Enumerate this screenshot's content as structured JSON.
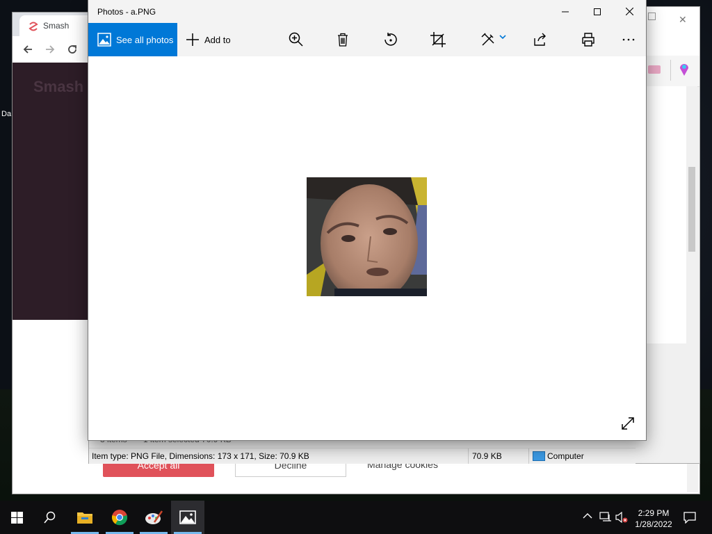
{
  "browser": {
    "tab_title": "Smash",
    "logo_text": "Smash",
    "cookie": {
      "accept_label": "Accept all",
      "decline_label": "Decline",
      "manage_label": "Manage cookies"
    }
  },
  "explorer": {
    "details_text": "Item type: PNG File, Dimensions: 173 x 171, Size: 70.9 KB",
    "size_text": "70.9 KB",
    "location_text": "Computer",
    "status_left": "3 items",
    "status_right": "1 item selected 70.9 KB"
  },
  "photos": {
    "title": "Photos - a.PNG",
    "toolbar": {
      "see_all_label": "See all photos",
      "add_to_label": "Add to",
      "icons": [
        "zoom-in-icon",
        "delete-icon",
        "rotate-icon",
        "crop-icon",
        "edit-create-icon",
        "share-icon",
        "print-icon",
        "more-icon"
      ]
    },
    "accent_color": "#0078d7"
  },
  "taskbar": {
    "time": "2:29 PM",
    "date": "1/28/2022",
    "apps": [
      "start-icon",
      "search-icon",
      "file-explorer-icon",
      "chrome-icon",
      "paint-icon",
      "photos-icon"
    ]
  },
  "desktop": {
    "icon_label": "Da"
  }
}
